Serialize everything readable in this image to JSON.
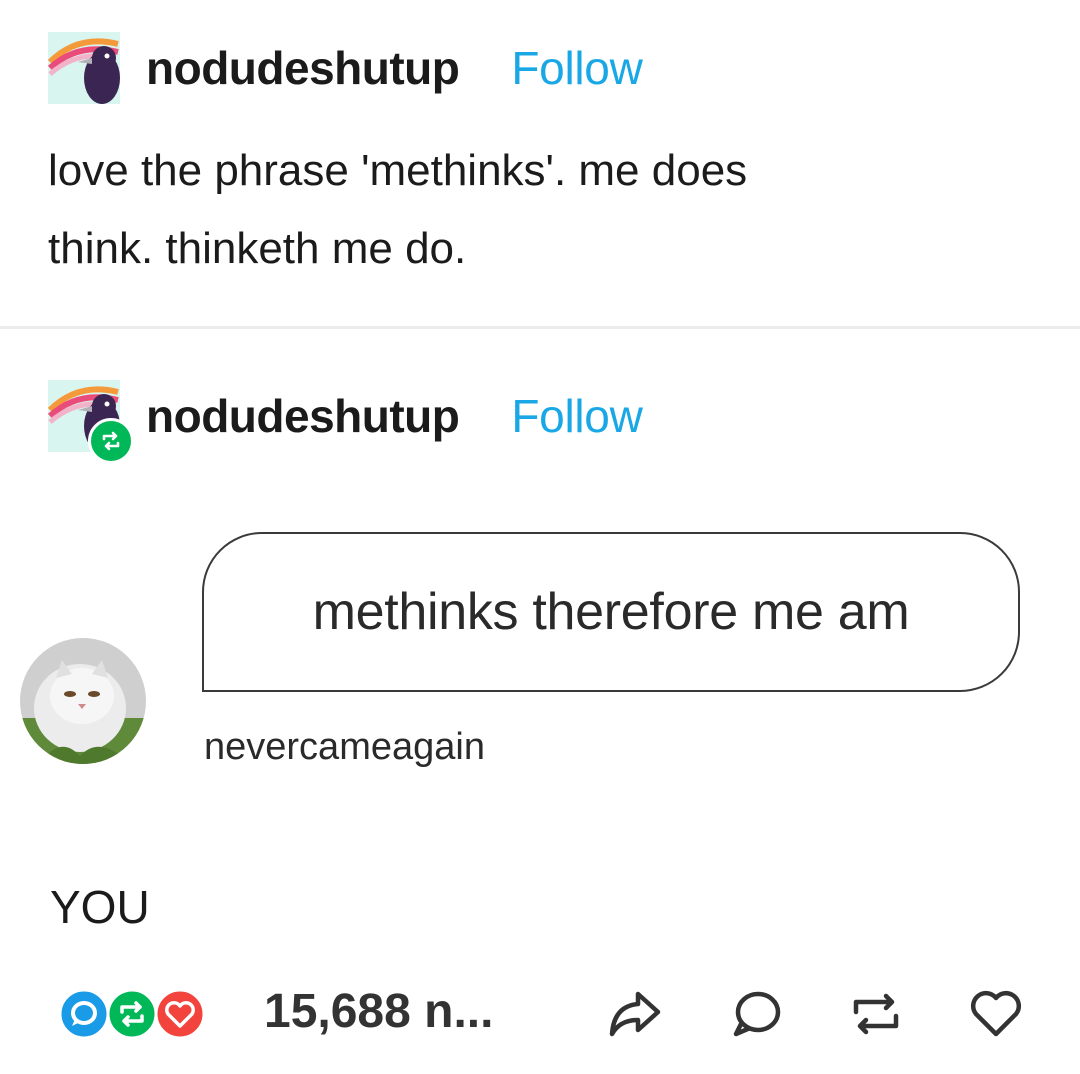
{
  "post": {
    "username": "nodudeshutup",
    "follow_label": "Follow",
    "text_line1": "love the phrase 'methinks'. me does",
    "text_line2": "think. thinketh me do."
  },
  "reblog": {
    "username": "nodudeshutup",
    "follow_label": "Follow",
    "quote": {
      "text": "methinks therefore me am",
      "author": "nevercameagain"
    },
    "reply": "YOU"
  },
  "footer": {
    "notes": "15,688 n...",
    "icons": [
      "comment-note-icon",
      "reblog-note-icon",
      "like-note-icon",
      "share-icon",
      "comment-icon",
      "reblog-icon",
      "heart-icon"
    ],
    "colors": {
      "blue": "#1a9be8",
      "green": "#00b858",
      "red": "#f2433d"
    }
  },
  "colors": {
    "follow": "#1aa7e6",
    "text": "#1b1b1b"
  }
}
